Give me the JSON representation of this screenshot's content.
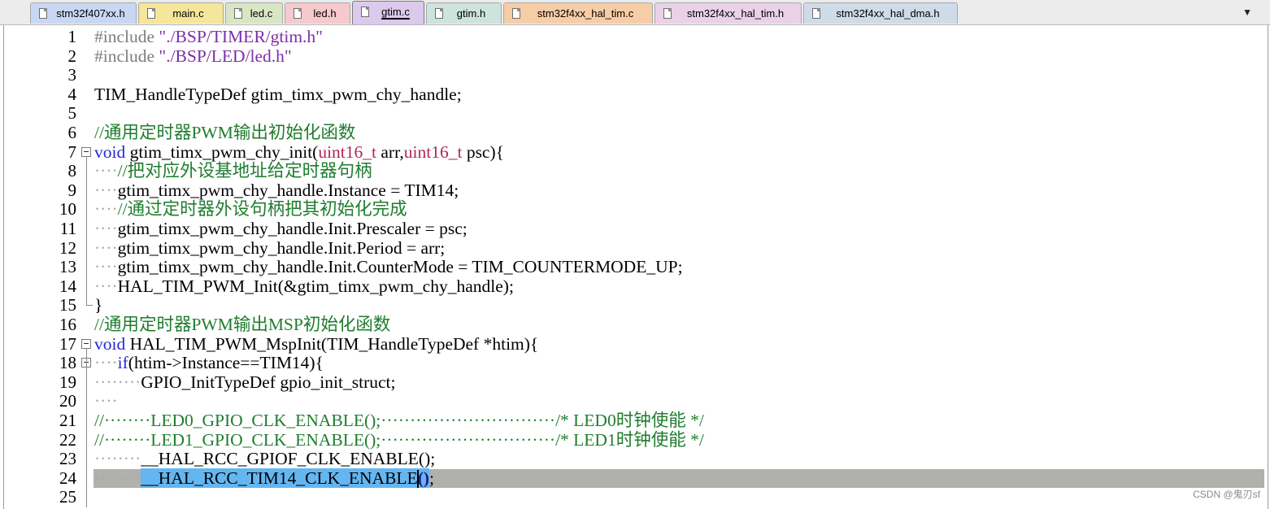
{
  "tabs": [
    {
      "label": "stm32f407xx.h",
      "color": "#c8d8f3"
    },
    {
      "label": "main.c",
      "color": "#f6e69a"
    },
    {
      "label": "led.c",
      "color": "#d9e6c3"
    },
    {
      "label": "led.h",
      "color": "#f6c9cd"
    },
    {
      "label": "gtim.c",
      "color": "#dcc9ee",
      "active": true
    },
    {
      "label": "gtim.h",
      "color": "#cde3dd"
    },
    {
      "label": "stm32f4xx_hal_tim.c",
      "color": "#f7cda6"
    },
    {
      "label": "stm32f4xx_hal_tim.h",
      "color": "#ead1e8"
    },
    {
      "label": "stm32f4xx_hal_dma.h",
      "color": "#cfdbe8"
    }
  ],
  "tab_menu_glyph": "▼",
  "editor": {
    "current_line": 24,
    "lines": [
      {
        "n": "1",
        "tokens": [
          [
            "pre",
            "#include "
          ],
          [
            "str",
            "\"./BSP/TIMER/gtim.h\""
          ]
        ]
      },
      {
        "n": "2",
        "tokens": [
          [
            "pre",
            "#include "
          ],
          [
            "str",
            "\"./BSP/LED/led.h\""
          ]
        ]
      },
      {
        "n": "3",
        "tokens": []
      },
      {
        "n": "4",
        "tokens": [
          [
            "plain",
            "TIM_HandleTypeDef gtim_timx_pwm_chy_handle;"
          ]
        ]
      },
      {
        "n": "5",
        "tokens": []
      },
      {
        "n": "6",
        "tokens": [
          [
            "cmt",
            "//通用定时器PWM输出初始化函数"
          ]
        ]
      },
      {
        "n": "7",
        "fold": "open",
        "tokens": [
          [
            "kw",
            "void"
          ],
          [
            "plain",
            " gtim_timx_pwm_chy_init("
          ],
          [
            "ty",
            "uint16_t"
          ],
          [
            "plain",
            " arr,"
          ],
          [
            "ty",
            "uint16_t"
          ],
          [
            "plain",
            " psc){"
          ]
        ]
      },
      {
        "n": "8",
        "tokens": [
          [
            "ws",
            "····"
          ],
          [
            "cmt",
            "//把对应外设基地址给定时器句柄"
          ]
        ]
      },
      {
        "n": "9",
        "tokens": [
          [
            "ws",
            "····"
          ],
          [
            "plain",
            "gtim_timx_pwm_chy_handle.Instance = TIM14;"
          ]
        ]
      },
      {
        "n": "10",
        "tokens": [
          [
            "ws",
            "····"
          ],
          [
            "cmt",
            "//通过定时器外设句柄把其初始化完成"
          ]
        ]
      },
      {
        "n": "11",
        "tokens": [
          [
            "ws",
            "····"
          ],
          [
            "plain",
            "gtim_timx_pwm_chy_handle.Init.Prescaler = psc;"
          ]
        ]
      },
      {
        "n": "12",
        "tokens": [
          [
            "ws",
            "····"
          ],
          [
            "plain",
            "gtim_timx_pwm_chy_handle.Init.Period = arr;"
          ]
        ]
      },
      {
        "n": "13",
        "tokens": [
          [
            "ws",
            "····"
          ],
          [
            "plain",
            "gtim_timx_pwm_chy_handle.Init.CounterMode = TIM_COUNTERMODE_UP;"
          ]
        ]
      },
      {
        "n": "14",
        "tokens": [
          [
            "ws",
            "····"
          ],
          [
            "plain",
            "HAL_TIM_PWM_Init(&gtim_timx_pwm_chy_handle);"
          ]
        ]
      },
      {
        "n": "15",
        "fold": "end",
        "tokens": [
          [
            "plain",
            "}"
          ]
        ]
      },
      {
        "n": "16",
        "tokens": [
          [
            "cmt",
            "//通用定时器PWM输出MSP初始化函数"
          ]
        ]
      },
      {
        "n": "17",
        "fold": "open",
        "tokens": [
          [
            "kw",
            "void"
          ],
          [
            "plain",
            " HAL_TIM_PWM_MspInit(TIM_HandleTypeDef *htim){"
          ]
        ]
      },
      {
        "n": "18",
        "fold": "open",
        "tokens": [
          [
            "ws",
            "····"
          ],
          [
            "kw",
            "if"
          ],
          [
            "plain",
            "(htim->Instance==TIM14){"
          ]
        ]
      },
      {
        "n": "19",
        "tokens": [
          [
            "ws",
            "········"
          ],
          [
            "plain",
            "GPIO_InitTypeDef gpio_init_struct;"
          ]
        ]
      },
      {
        "n": "20",
        "tokens": [
          [
            "ws",
            "····"
          ]
        ]
      },
      {
        "n": "21",
        "tokens": [
          [
            "cmt",
            "//········LED0_GPIO_CLK_ENABLE();······························/* LED0时钟使能 */"
          ]
        ]
      },
      {
        "n": "22",
        "tokens": [
          [
            "cmt",
            "//········LED1_GPIO_CLK_ENABLE();······························/* LED1时钟使能 */"
          ]
        ]
      },
      {
        "n": "23",
        "tokens": [
          [
            "ws",
            "········"
          ],
          [
            "plain",
            "__HAL_RCC_GPIOF_CLK_ENABLE();"
          ]
        ]
      },
      {
        "n": "24",
        "tokens": [
          [
            "ws",
            "········"
          ],
          [
            "sel",
            "__HAL_RCC_TIM14_CLK_ENABLE"
          ],
          [
            "brace",
            "()"
          ],
          [
            "plain",
            ";"
          ]
        ]
      },
      {
        "n": "25",
        "tokens": []
      }
    ]
  },
  "watermark": "CSDN @鬼刃sf"
}
